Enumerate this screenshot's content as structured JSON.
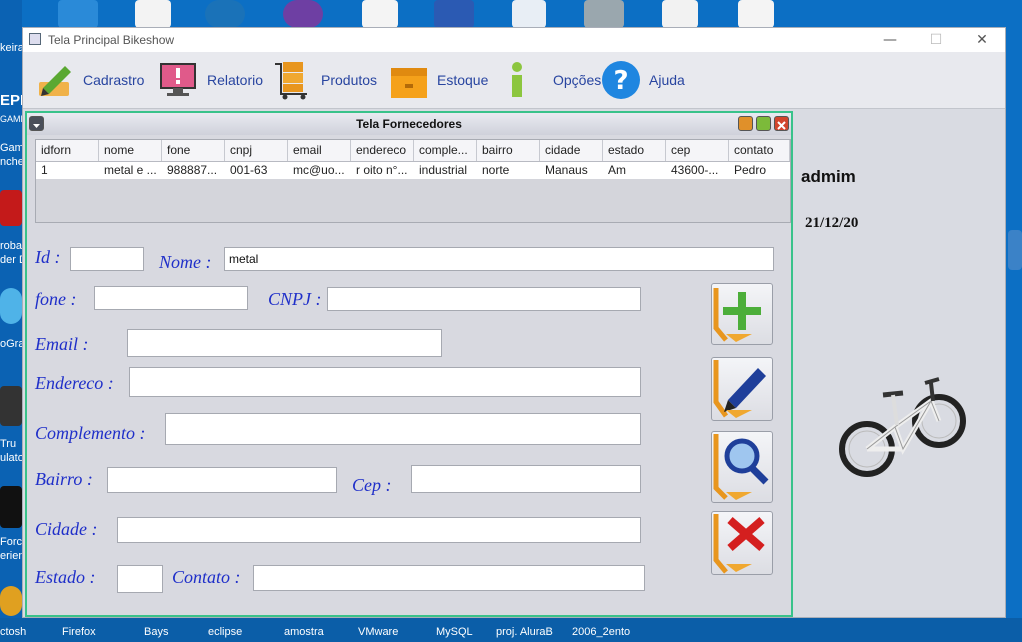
{
  "desktop": {
    "left_labels": [
      "keira",
      "EPIC",
      "GAMES",
      "Gam",
      "nche",
      "roba",
      "der D",
      "oGra",
      "Tru",
      "ulato",
      "Forc",
      "erien"
    ],
    "bottom_labels": [
      "ctosh",
      "Firefox",
      "Bays",
      "eclipse",
      "amostra",
      "VMware",
      "MySQL",
      "proj. AluraB",
      "2006_2ento"
    ]
  },
  "window": {
    "title": "Tela Principal Bikeshow",
    "controls": {
      "minimize": "—",
      "maximize": "☐",
      "close": "✕"
    }
  },
  "menu": [
    {
      "label": "Cadrastro",
      "icon": "register-pen-icon"
    },
    {
      "label": "Relatorio",
      "icon": "monitor-report-icon"
    },
    {
      "label": "Produtos",
      "icon": "cart-products-icon"
    },
    {
      "label": "Estoque",
      "icon": "box-stock-icon"
    },
    {
      "label": "Opções",
      "icon": "info-icon"
    },
    {
      "label": "Ajuda",
      "icon": "help-icon"
    }
  ],
  "internal_frame": {
    "title": "Tela Fornecedores",
    "table": {
      "columns": [
        "idforn",
        "nome",
        "fone",
        "cnpj",
        "email",
        "endereco",
        "comple...",
        "bairro",
        "cidade",
        "estado",
        "cep",
        "contato"
      ],
      "rows": [
        [
          "1",
          "metal e ...",
          "988887...",
          "001-63",
          "mc@uo...",
          "r oito n°...",
          "industrial",
          "norte",
          "Manaus",
          "Am",
          "43600-...",
          "Pedro"
        ]
      ]
    },
    "form": {
      "id": {
        "label": "Id :",
        "value": ""
      },
      "nome": {
        "label": "Nome :",
        "value": "metal"
      },
      "fone": {
        "label": "fone :",
        "value": ""
      },
      "cnpj": {
        "label": "CNPJ :",
        "value": ""
      },
      "email": {
        "label": "Email :",
        "value": ""
      },
      "endereco": {
        "label": "Endereco :",
        "value": ""
      },
      "complemento": {
        "label": "Complemento :",
        "value": ""
      },
      "bairro": {
        "label": "Bairro :",
        "value": ""
      },
      "cep": {
        "label": "Cep :",
        "value": ""
      },
      "cidade": {
        "label": "Cidade :",
        "value": ""
      },
      "estado": {
        "label": "Estado :",
        "value": ""
      },
      "contato": {
        "label": "Contato :",
        "value": ""
      }
    },
    "actions": [
      {
        "name": "add-button",
        "icon": "plus-icon"
      },
      {
        "name": "edit-button",
        "icon": "pen-icon"
      },
      {
        "name": "search-button",
        "icon": "magnifier-icon"
      },
      {
        "name": "delete-button",
        "icon": "x-icon"
      }
    ]
  },
  "sidebar": {
    "user": "admim",
    "date": "21/12/20",
    "image": "bicycle-image"
  },
  "colors": {
    "label_blue": "#1f2fc9",
    "menu_text": "#2845a0",
    "frame_border": "#39c28a",
    "desktop": "#0c6fc4"
  }
}
